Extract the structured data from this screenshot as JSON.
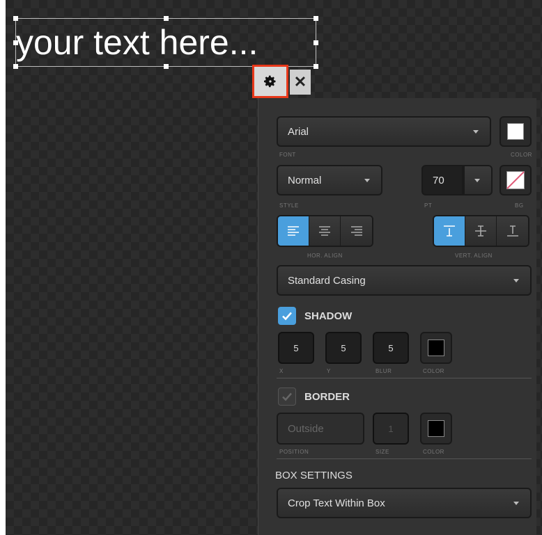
{
  "canvas": {
    "text": "your text here..."
  },
  "toolbar": {
    "settings_icon": "gear-icon",
    "close_symbol": "✕"
  },
  "panel": {
    "font": {
      "value": "Arial",
      "label": "FONT"
    },
    "font_color": {
      "label": "COLOR",
      "color": "#ffffff"
    },
    "style": {
      "value": "Normal",
      "label": "STYLE"
    },
    "size": {
      "value": "70",
      "label": "PT"
    },
    "bg": {
      "label": "BG",
      "color": "none"
    },
    "hor_align": {
      "label": "HOR. ALIGN",
      "options": [
        "left",
        "center",
        "right"
      ],
      "selected": "left"
    },
    "vert_align": {
      "label": "VERT. ALIGN",
      "options": [
        "top",
        "middle",
        "bottom"
      ],
      "selected": "top"
    },
    "casing": {
      "value": "Standard Casing"
    },
    "shadow": {
      "title": "SHADOW",
      "checked": true,
      "x": "5",
      "x_label": "X",
      "y": "5",
      "y_label": "Y",
      "blur": "5",
      "blur_label": "BLUR",
      "color_label": "COLOR",
      "color": "#000000"
    },
    "border": {
      "title": "BORDER",
      "checked": false,
      "position": "Outside",
      "position_label": "POSITION",
      "size": "1",
      "size_label": "SIZE",
      "color_label": "COLOR",
      "color": "#000000"
    },
    "box_settings": {
      "title": "BOX SETTINGS",
      "value": "Crop Text Within Box"
    }
  },
  "colors": {
    "accent": "#4a9fdd",
    "highlight": "#e8381a",
    "panel_bg": "#333333"
  }
}
